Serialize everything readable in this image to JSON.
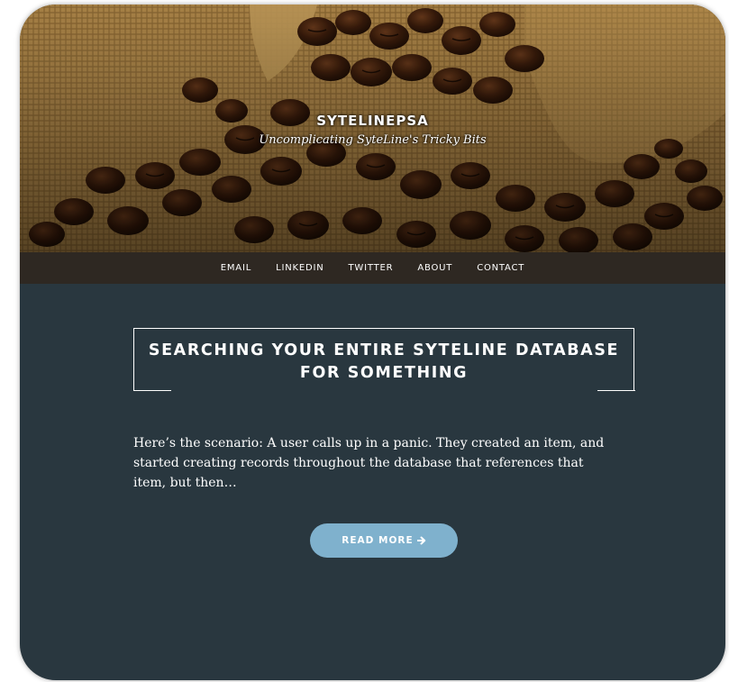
{
  "site": {
    "title": "SYTELINEPSA",
    "tagline": "Uncomplicating SyteLine's Tricky Bits"
  },
  "nav": {
    "items": [
      {
        "label": "EMAIL"
      },
      {
        "label": "LINKEDIN"
      },
      {
        "label": "TWITTER"
      },
      {
        "label": "ABOUT"
      },
      {
        "label": "CONTACT"
      }
    ]
  },
  "post": {
    "title": "SEARCHING YOUR ENTIRE SYTELINE DATABASE FOR SOMETHING",
    "excerpt": "Here’s the scenario: A user calls up in a panic. They created an item, and started creating records throughout the database that references that item, but then…",
    "read_more_label": "READ MORE",
    "read_more_icon": "arrow-right-icon"
  },
  "colors": {
    "content_bg": "#29373f",
    "nav_bg": "#2e2822",
    "button_bg": "#7fb1cd",
    "text": "#ffffff"
  }
}
